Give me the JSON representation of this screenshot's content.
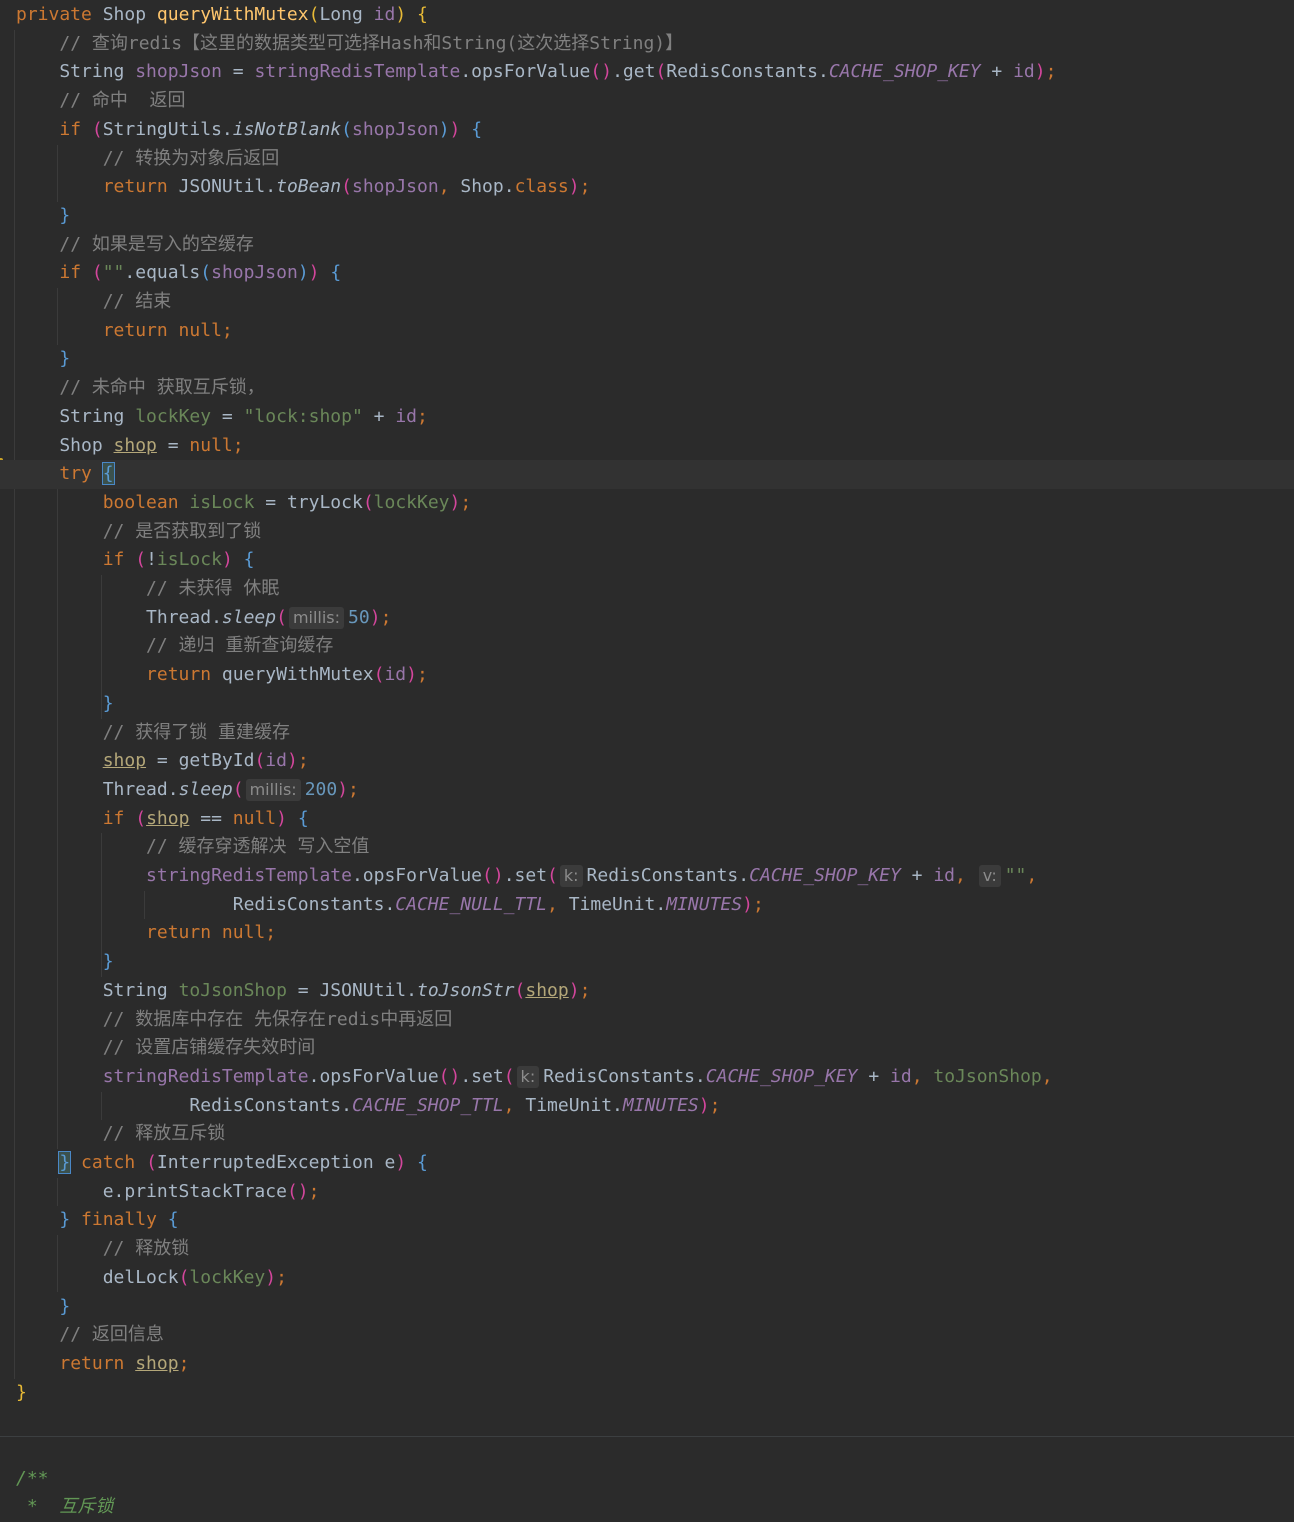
{
  "editor": {
    "background": "#2b2b2b",
    "current_line": 16,
    "lines": [
      [
        [
          "kw",
          "private "
        ],
        [
          "tp",
          "Shop "
        ],
        [
          "fn",
          "queryWithMutex"
        ],
        [
          "p1",
          "("
        ],
        [
          "tp",
          "Long "
        ],
        [
          "var",
          "id"
        ],
        [
          "p1",
          ")"
        ],
        [
          "tp",
          " "
        ],
        [
          "p1",
          "{"
        ]
      ],
      [
        [
          "tp",
          "    "
        ],
        [
          "cmt",
          "// 查询redis【这里的数据类型可选择Hash和String(这次选择String)】"
        ]
      ],
      [
        [
          "tp",
          "    String "
        ],
        [
          "var",
          "shopJson"
        ],
        [
          "tp",
          " = "
        ],
        [
          "fld",
          "stringRedisTemplate"
        ],
        [
          "tp",
          ".opsForValue"
        ],
        [
          "p2",
          "()"
        ],
        [
          "tp",
          ".get"
        ],
        [
          "p2",
          "("
        ],
        [
          "tp",
          "RedisConstants."
        ],
        [
          "cfld",
          "CACHE_SHOP_KEY"
        ],
        [
          "tp",
          " + "
        ],
        [
          "var",
          "id"
        ],
        [
          "p2",
          ")"
        ],
        [
          "kw",
          ";"
        ]
      ],
      [
        [
          "tp",
          "    "
        ],
        [
          "cmt",
          "// 命中  返回"
        ]
      ],
      [
        [
          "tp",
          "    "
        ],
        [
          "kw",
          "if "
        ],
        [
          "p2",
          "("
        ],
        [
          "tp",
          "StringUtils."
        ],
        [
          "st",
          "isNotBlank"
        ],
        [
          "p3",
          "("
        ],
        [
          "var",
          "shopJson"
        ],
        [
          "p3",
          ")"
        ],
        [
          "p2",
          ")"
        ],
        [
          "tp",
          " "
        ],
        [
          "b",
          "{"
        ]
      ],
      [
        [
          "tp",
          "        "
        ],
        [
          "cmt",
          "// 转换为对象后返回"
        ]
      ],
      [
        [
          "tp",
          "        "
        ],
        [
          "kw",
          "return "
        ],
        [
          "tp",
          "JSONUtil."
        ],
        [
          "st",
          "toBean"
        ],
        [
          "p2",
          "("
        ],
        [
          "var",
          "shopJson"
        ],
        [
          "kw",
          ", "
        ],
        [
          "tp",
          "Shop."
        ],
        [
          "kw",
          "class"
        ],
        [
          "p2",
          ")"
        ],
        [
          "kw",
          ";"
        ]
      ],
      [
        [
          "tp",
          "    "
        ],
        [
          "b",
          "}"
        ]
      ],
      [
        [
          "tp",
          "    "
        ],
        [
          "cmt",
          "// 如果是写入的空缓存"
        ]
      ],
      [
        [
          "tp",
          "    "
        ],
        [
          "kw",
          "if "
        ],
        [
          "p2",
          "("
        ],
        [
          "str",
          "\"\""
        ],
        [
          "tp",
          ".equals"
        ],
        [
          "p3",
          "("
        ],
        [
          "var",
          "shopJson"
        ],
        [
          "p3",
          ")"
        ],
        [
          "p2",
          ")"
        ],
        [
          "tp",
          " "
        ],
        [
          "b",
          "{"
        ]
      ],
      [
        [
          "tp",
          "        "
        ],
        [
          "cmt",
          "// 结束"
        ]
      ],
      [
        [
          "tp",
          "        "
        ],
        [
          "kw",
          "return null;"
        ]
      ],
      [
        [
          "tp",
          "    "
        ],
        [
          "b",
          "}"
        ]
      ],
      [
        [
          "tp",
          "    "
        ],
        [
          "cmt",
          "// 未命中 获取互斥锁，"
        ]
      ],
      [
        [
          "tp",
          "    String "
        ],
        [
          "lv",
          "lockKey"
        ],
        [
          "tp",
          " = "
        ],
        [
          "str",
          "\"lock:shop\""
        ],
        [
          "tp",
          " + "
        ],
        [
          "var",
          "id"
        ],
        [
          "kw",
          ";"
        ]
      ],
      [
        [
          "tp",
          "    Shop "
        ],
        [
          "lvu",
          "shop"
        ],
        [
          "tp",
          " = "
        ],
        [
          "kw",
          "null;"
        ]
      ],
      [
        [
          "tp",
          "    "
        ],
        [
          "kw",
          "try "
        ],
        [
          "bh",
          "{"
        ]
      ],
      [
        [
          "tp",
          "        "
        ],
        [
          "kw",
          "boolean "
        ],
        [
          "lv",
          "isLock"
        ],
        [
          "tp",
          " = tryLock"
        ],
        [
          "p2",
          "("
        ],
        [
          "lv",
          "lockKey"
        ],
        [
          "p2",
          ")"
        ],
        [
          "kw",
          ";"
        ]
      ],
      [
        [
          "tp",
          "        "
        ],
        [
          "cmt",
          "// 是否获取到了锁"
        ]
      ],
      [
        [
          "tp",
          "        "
        ],
        [
          "kw",
          "if "
        ],
        [
          "p2",
          "("
        ],
        [
          "tp",
          "!"
        ],
        [
          "lv",
          "isLock"
        ],
        [
          "p2",
          ")"
        ],
        [
          "tp",
          " "
        ],
        [
          "b",
          "{"
        ]
      ],
      [
        [
          "tp",
          "            "
        ],
        [
          "cmt",
          "// 未获得 休眠"
        ]
      ],
      [
        [
          "tp",
          "            Thread."
        ],
        [
          "st",
          "sleep"
        ],
        [
          "p2",
          "("
        ],
        [
          "hint",
          "millis:"
        ],
        [
          "num",
          "50"
        ],
        [
          "p2",
          ")"
        ],
        [
          "kw",
          ";"
        ]
      ],
      [
        [
          "tp",
          "            "
        ],
        [
          "cmt",
          "// 递归 重新查询缓存"
        ]
      ],
      [
        [
          "tp",
          "            "
        ],
        [
          "kw",
          "return "
        ],
        [
          "tp",
          "queryWithMutex"
        ],
        [
          "p2",
          "("
        ],
        [
          "var",
          "id"
        ],
        [
          "p2",
          ")"
        ],
        [
          "kw",
          ";"
        ]
      ],
      [
        [
          "tp",
          "        "
        ],
        [
          "b",
          "}"
        ]
      ],
      [
        [
          "tp",
          "        "
        ],
        [
          "cmt",
          "// 获得了锁 重建缓存"
        ]
      ],
      [
        [
          "tp",
          "        "
        ],
        [
          "lvu",
          "shop"
        ],
        [
          "tp",
          " = getById"
        ],
        [
          "p2",
          "("
        ],
        [
          "var",
          "id"
        ],
        [
          "p2",
          ")"
        ],
        [
          "kw",
          ";"
        ]
      ],
      [
        [
          "tp",
          "        Thread."
        ],
        [
          "st",
          "sleep"
        ],
        [
          "p2",
          "("
        ],
        [
          "hint",
          "millis:"
        ],
        [
          "num",
          "200"
        ],
        [
          "p2",
          ")"
        ],
        [
          "kw",
          ";"
        ]
      ],
      [
        [
          "tp",
          "        "
        ],
        [
          "kw",
          "if "
        ],
        [
          "p2",
          "("
        ],
        [
          "lvu",
          "shop"
        ],
        [
          "tp",
          " == "
        ],
        [
          "kw",
          "null"
        ],
        [
          "p2",
          ")"
        ],
        [
          "tp",
          " "
        ],
        [
          "b",
          "{"
        ]
      ],
      [
        [
          "tp",
          "            "
        ],
        [
          "cmt",
          "// 缓存穿透解决 写入空值"
        ]
      ],
      [
        [
          "tp",
          "            "
        ],
        [
          "fld",
          "stringRedisTemplate"
        ],
        [
          "tp",
          ".opsForValue"
        ],
        [
          "p2",
          "()"
        ],
        [
          "tp",
          ".set"
        ],
        [
          "p2",
          "("
        ],
        [
          "hint",
          "k:"
        ],
        [
          "tp",
          "RedisConstants."
        ],
        [
          "cfld",
          "CACHE_SHOP_KEY"
        ],
        [
          "tp",
          " + "
        ],
        [
          "var",
          "id"
        ],
        [
          "kw",
          ", "
        ],
        [
          "hint",
          "v:"
        ],
        [
          "str",
          "\"\""
        ],
        [
          "kw",
          ","
        ]
      ],
      [
        [
          "tp",
          "                    RedisConstants."
        ],
        [
          "cfld",
          "CACHE_NULL_TTL"
        ],
        [
          "kw",
          ", "
        ],
        [
          "tp",
          "TimeUnit."
        ],
        [
          "cfld",
          "MINUTES"
        ],
        [
          "p2",
          ")"
        ],
        [
          "kw",
          ";"
        ]
      ],
      [
        [
          "tp",
          "            "
        ],
        [
          "kw",
          "return null;"
        ]
      ],
      [
        [
          "tp",
          "        "
        ],
        [
          "b",
          "}"
        ]
      ],
      [
        [
          "tp",
          "        String "
        ],
        [
          "lv",
          "toJsonShop"
        ],
        [
          "tp",
          " = JSONUtil."
        ],
        [
          "st",
          "toJsonStr"
        ],
        [
          "p2",
          "("
        ],
        [
          "lvu",
          "shop"
        ],
        [
          "p2",
          ")"
        ],
        [
          "kw",
          ";"
        ]
      ],
      [
        [
          "tp",
          "        "
        ],
        [
          "cmt",
          "// 数据库中存在 先保存在redis中再返回"
        ]
      ],
      [
        [
          "tp",
          "        "
        ],
        [
          "cmt",
          "// 设置店铺缓存失效时间"
        ]
      ],
      [
        [
          "tp",
          "        "
        ],
        [
          "fld",
          "stringRedisTemplate"
        ],
        [
          "tp",
          ".opsForValue"
        ],
        [
          "p2",
          "()"
        ],
        [
          "tp",
          ".set"
        ],
        [
          "p2",
          "("
        ],
        [
          "hint",
          "k:"
        ],
        [
          "tp",
          "RedisConstants."
        ],
        [
          "cfld",
          "CACHE_SHOP_KEY"
        ],
        [
          "tp",
          " + "
        ],
        [
          "var",
          "id"
        ],
        [
          "kw",
          ", "
        ],
        [
          "lv",
          "toJsonShop"
        ],
        [
          "kw",
          ","
        ]
      ],
      [
        [
          "tp",
          "                RedisConstants."
        ],
        [
          "cfld",
          "CACHE_SHOP_TTL"
        ],
        [
          "kw",
          ", "
        ],
        [
          "tp",
          "TimeUnit."
        ],
        [
          "cfld",
          "MINUTES"
        ],
        [
          "p2",
          ")"
        ],
        [
          "kw",
          ";"
        ]
      ],
      [
        [
          "tp",
          "        "
        ],
        [
          "cmt",
          "// 释放互斥锁"
        ]
      ],
      [
        [
          "tp",
          "    "
        ],
        [
          "bh",
          "}"
        ],
        [
          "tp",
          " "
        ],
        [
          "kw",
          "catch "
        ],
        [
          "p2",
          "("
        ],
        [
          "tp",
          "InterruptedException e"
        ],
        [
          "p2",
          ")"
        ],
        [
          "tp",
          " "
        ],
        [
          "b",
          "{"
        ]
      ],
      [
        [
          "tp",
          "        e.printStackTrace"
        ],
        [
          "p2",
          "()"
        ],
        [
          "kw",
          ";"
        ]
      ],
      [
        [
          "tp",
          "    "
        ],
        [
          "b",
          "}"
        ],
        [
          "tp",
          " "
        ],
        [
          "kw",
          "finally "
        ],
        [
          "b",
          "{"
        ]
      ],
      [
        [
          "tp",
          "        "
        ],
        [
          "cmt",
          "// 释放锁"
        ]
      ],
      [
        [
          "tp",
          "        delLock"
        ],
        [
          "p2",
          "("
        ],
        [
          "lv",
          "lockKey"
        ],
        [
          "p2",
          ")"
        ],
        [
          "kw",
          ";"
        ]
      ],
      [
        [
          "tp",
          "    "
        ],
        [
          "b",
          "}"
        ]
      ],
      [
        [
          "tp",
          "    "
        ],
        [
          "cmt",
          "// 返回信息"
        ]
      ],
      [
        [
          "tp",
          "    "
        ],
        [
          "kw",
          "return "
        ],
        [
          "lvu",
          "shop"
        ],
        [
          "kw",
          ";"
        ]
      ],
      [
        [
          "p1",
          "}"
        ]
      ],
      [
        [
          "tp",
          ""
        ]
      ],
      [
        [
          "tp",
          ""
        ]
      ],
      [
        [
          "doc",
          "/**"
        ]
      ],
      [
        [
          "doc",
          " *  互斥锁"
        ]
      ]
    ]
  }
}
